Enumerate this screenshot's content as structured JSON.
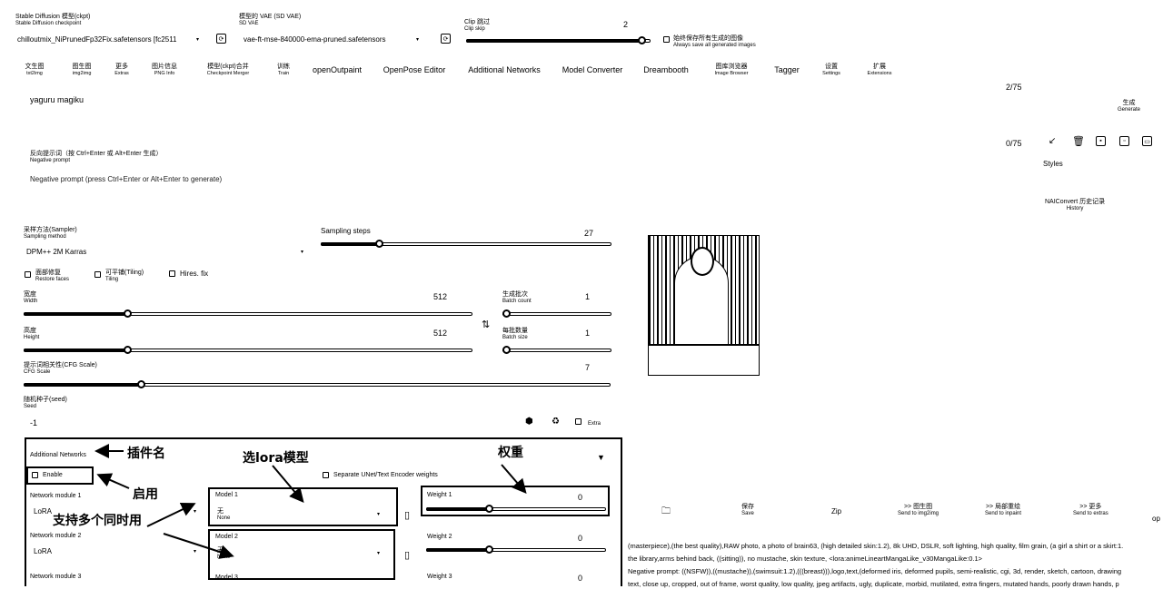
{
  "top": {
    "checkpoint_label_zh": "Stable Diffusion 模型(ckpt)",
    "checkpoint_label_en": "Stable Diffusion checkpoint",
    "checkpoint_value": "chilloutmix_NiPrunedFp32Fix.safetensors [fc2511",
    "vae_label_zh": "模型的 VAE (SD VAE)",
    "vae_label_en": "SD VAE",
    "vae_value": "vae-ft-mse-840000-ema-pruned.safetensors",
    "clip_label_zh": "Clip 跳过",
    "clip_label_en": "Clip skip",
    "clip_value": "2",
    "clip_fraction": 0.95,
    "save_all_zh": "始终保存所有生成的图像",
    "save_all_en": "Always save all generated images"
  },
  "tabs": [
    {
      "zh": "文生图",
      "en": "txt2img"
    },
    {
      "zh": "图生图",
      "en": "img2img"
    },
    {
      "zh": "更多",
      "en": "Extras"
    },
    {
      "zh": "图片信息",
      "en": "PNG Info"
    },
    {
      "zh": "模型(ckpt)合并",
      "en": "Checkpoint Merger"
    },
    {
      "zh": "训练",
      "en": "Train"
    },
    {
      "single": "openOutpaint"
    },
    {
      "single": "OpenPose Editor"
    },
    {
      "single": "Additional Networks"
    },
    {
      "single": "Model Converter"
    },
    {
      "single": "Dreambooth"
    },
    {
      "zh": "图库浏览器",
      "en": "Image Browser"
    },
    {
      "single": "Tagger"
    },
    {
      "zh": "设置",
      "en": "Settings"
    },
    {
      "zh": "扩展",
      "en": "Extensions"
    }
  ],
  "prompt": {
    "value": "yaguru magiku",
    "counter": "2/75",
    "neg_label_zh": "反向提示词（按 Ctrl+Enter 或 Alt+Enter 生成）",
    "neg_label_en": "Negative prompt",
    "neg_placeholder": "Negative prompt (press Ctrl+Enter or Alt+Enter to generate)",
    "neg_counter": "0/75"
  },
  "right": {
    "generate_zh": "生成",
    "generate_en": "Generate",
    "styles_label": "Styles",
    "history_zh": "NAIConvert 历史记录",
    "history_en": "History"
  },
  "sampling": {
    "method_label_zh": "采样方法(Sampler)",
    "method_label_en": "Sampling method",
    "method_value": "DPM++ 2M Karras",
    "steps_label": "Sampling steps",
    "steps_value": "27",
    "steps_fraction": 0.2
  },
  "checks": {
    "restore_zh": "面部修复",
    "restore_en": "Restore faces",
    "tiling_zh": "可平铺(Tiling)",
    "tiling_en": "Tiling",
    "hires": "Hires. fix"
  },
  "size": {
    "width_zh": "宽度",
    "width_en": "Width",
    "width_value": "512",
    "width_fraction": 0.23,
    "height_zh": "高度",
    "height_en": "Height",
    "height_value": "512",
    "height_fraction": 0.23,
    "swap_icon": "⇅",
    "batch_count_zh": "生成批次",
    "batch_count_en": "Batch count",
    "batch_count_value": "1",
    "batch_size_zh": "每批数量",
    "batch_size_en": "Batch size",
    "batch_size_value": "1"
  },
  "cfg": {
    "label_zh": "提示词相关性(CFG Scale)",
    "label_en": "CFG Scale",
    "value": "7",
    "fraction": 0.2
  },
  "seed": {
    "label_zh": "随机种子(seed)",
    "label_en": "Seed",
    "value": "-1",
    "extra_label": "Extra"
  },
  "addnet": {
    "title": "Additional Networks",
    "enable_label": "Enable",
    "separate_label": "Separate UNet/Text Encoder weights",
    "modules": [
      {
        "label": "Network module 1",
        "value": "LoRA",
        "model_label": "Model 1",
        "model_value_zh": "无",
        "model_value_en": "None",
        "weight_label": "Weight 1",
        "weight_value": "0",
        "weight_fraction": 0.35
      },
      {
        "label": "Network module 2",
        "value": "LoRA",
        "model_label": "Model 2",
        "model_value_zh": "无",
        "model_value_en": "None",
        "weight_label": "Weight 2",
        "weight_value": "0",
        "weight_fraction": 0.35
      },
      {
        "label": "Network module 3",
        "value": "",
        "model_label": "Model 3",
        "model_value_zh": "",
        "model_value_en": "",
        "weight_label": "Weight 3",
        "weight_value": "0",
        "weight_fraction": 0.35
      }
    ]
  },
  "annotations": {
    "plugin_name": "插件名",
    "enable": "启用",
    "choose_lora": "选lora模型",
    "weight": "权重",
    "multi": "支持多个同时用"
  },
  "output_buttons": [
    {
      "zh": "",
      "en": ""
    },
    {
      "zh": "保存",
      "en": "Save"
    },
    {
      "zh": "Zip",
      "en": ""
    },
    {
      "zh": ">> 图生图",
      "en": "Send to img2img"
    },
    {
      "zh": ">> 局部重绘",
      "en": "Send to inpaint"
    },
    {
      "zh": ">> 更多",
      "en": "Send to extras"
    },
    {
      "zh": "op",
      "en": ""
    }
  ],
  "info": {
    "line1": "(masterpiece),(the best quality),RAW photo, a photo of brain63, (high detailed skin:1.2), 8k UHD, DSLR, soft lighting, high quality, film grain, (a girl a shirt or a skirt:1.",
    "line2": "the library,arms behind back, ((sitting)), no mustache, skin texture, <lora:animeLineartMangaLike_v30MangaLike:0.1>",
    "line3": "Negative prompt: ((NSFW)),((mustache)),(swimsuit:1.2),(((breast))),logo,text,(deformed iris, deformed pupils, semi-realistic, cgi, 3d, render, sketch, cartoon, drawing",
    "line4": "text, close up, cropped, out of frame, worst quality, low quality, jpeg artifacts, ugly, duplicate, morbid, mutilated, extra fingers, mutated hands, poorly drawn hands, p"
  }
}
